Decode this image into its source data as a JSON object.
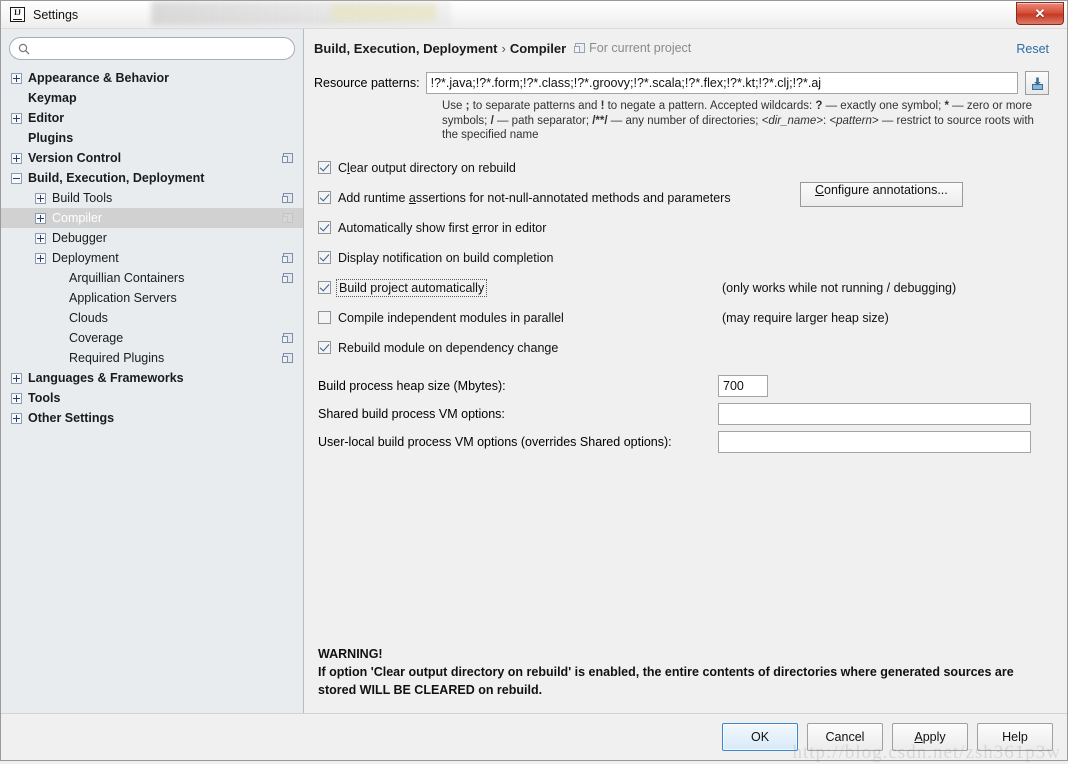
{
  "window": {
    "title": "Settings",
    "app_icon": "intellij-idea-icon",
    "close_label": "✕"
  },
  "sidebar": {
    "search": {
      "value": "",
      "placeholder": "",
      "icon": "search-icon"
    },
    "items": [
      {
        "label": "Appearance & Behavior",
        "toggle": "plus",
        "level": 1,
        "bold": true,
        "selected": false,
        "project_icon": false
      },
      {
        "label": "Keymap",
        "toggle": "none",
        "level": 1,
        "bold": true,
        "selected": false,
        "project_icon": false
      },
      {
        "label": "Editor",
        "toggle": "plus",
        "level": 1,
        "bold": true,
        "selected": false,
        "project_icon": false
      },
      {
        "label": "Plugins",
        "toggle": "none",
        "level": 1,
        "bold": true,
        "selected": false,
        "project_icon": false
      },
      {
        "label": "Version Control",
        "toggle": "plus",
        "level": 1,
        "bold": true,
        "selected": false,
        "project_icon": true
      },
      {
        "label": "Build, Execution, Deployment",
        "toggle": "minus",
        "level": 1,
        "bold": true,
        "selected": false,
        "project_icon": false
      },
      {
        "label": "Build Tools",
        "toggle": "plus",
        "level": 2,
        "bold": false,
        "selected": false,
        "project_icon": true
      },
      {
        "label": "Compiler",
        "toggle": "plus",
        "level": 2,
        "bold": false,
        "selected": true,
        "project_icon": true
      },
      {
        "label": "Debugger",
        "toggle": "plus",
        "level": 2,
        "bold": false,
        "selected": false,
        "project_icon": false
      },
      {
        "label": "Deployment",
        "toggle": "plus",
        "level": 2,
        "bold": false,
        "selected": false,
        "project_icon": true
      },
      {
        "label": "Arquillian Containers",
        "toggle": "none",
        "level": 3,
        "bold": false,
        "selected": false,
        "project_icon": true
      },
      {
        "label": "Application Servers",
        "toggle": "none",
        "level": 3,
        "bold": false,
        "selected": false,
        "project_icon": false
      },
      {
        "label": "Clouds",
        "toggle": "none",
        "level": 3,
        "bold": false,
        "selected": false,
        "project_icon": false
      },
      {
        "label": "Coverage",
        "toggle": "none",
        "level": 3,
        "bold": false,
        "selected": false,
        "project_icon": true
      },
      {
        "label": "Required Plugins",
        "toggle": "none",
        "level": 3,
        "bold": false,
        "selected": false,
        "project_icon": true
      },
      {
        "label": "Languages & Frameworks",
        "toggle": "plus",
        "level": 1,
        "bold": true,
        "selected": false,
        "project_icon": false
      },
      {
        "label": "Tools",
        "toggle": "plus",
        "level": 1,
        "bold": true,
        "selected": false,
        "project_icon": false
      },
      {
        "label": "Other Settings",
        "toggle": "plus",
        "level": 1,
        "bold": true,
        "selected": false,
        "project_icon": false
      }
    ]
  },
  "main": {
    "breadcrumb": {
      "root": "Build, Execution, Deployment",
      "separator": "›",
      "leaf": "Compiler"
    },
    "scope_label": "For current project",
    "reset_label": "Reset",
    "resource_patterns": {
      "label": "Resource patterns:",
      "value": "!?*.java;!?*.form;!?*.class;!?*.groovy;!?*.scala;!?*.flex;!?*.kt;!?*.clj;!?*.aj",
      "button_icon": "import-to-project-icon"
    },
    "hint": {
      "line1_a": "Use ",
      "line1_semi": ";",
      "line1_b": " to separate patterns and ",
      "line1_bang": "!",
      "line1_c": " to negate a pattern. Accepted wildcards: ",
      "line1_q": "?",
      "line1_d": " — exactly one symbol; ",
      "line1_star": "*",
      "line1_e": " — zero or more symbols; ",
      "line2_slash": "/",
      "line2_a": " — path separator; ",
      "line2_dstar": "/**/",
      "line2_b": " — any number of directories; ",
      "line2_dir": "<dir_name>",
      "line2_colon": ": ",
      "line2_pat": "<pattern>",
      "line2_c": " — restrict to source roots with the specified name"
    },
    "checkboxes": [
      {
        "label_pre": "C",
        "label_mn": "l",
        "label_post": "ear output directory on rebuild",
        "checked": true,
        "focused": false,
        "note": "",
        "button": ""
      },
      {
        "label_pre": "Add runtime ",
        "label_mn": "a",
        "label_post": "ssertions for not-null-annotated methods and parameters",
        "checked": true,
        "focused": false,
        "note": "",
        "button": "Configure annotations..."
      },
      {
        "label_pre": "Automatically show first ",
        "label_mn": "e",
        "label_post": "rror in editor",
        "checked": true,
        "focused": false,
        "note": "",
        "button": ""
      },
      {
        "label_pre": "Display notification on build completion",
        "label_mn": "",
        "label_post": "",
        "checked": true,
        "focused": false,
        "note": "",
        "button": ""
      },
      {
        "label_pre": "Build project automatically",
        "label_mn": "",
        "label_post": "",
        "checked": true,
        "focused": true,
        "note": "(only works while not running / debugging)",
        "button": ""
      },
      {
        "label_pre": "Compile independent modules in parallel",
        "label_mn": "",
        "label_post": "",
        "checked": false,
        "focused": false,
        "note": "(may require larger heap size)",
        "button": ""
      },
      {
        "label_pre": "Rebuild module on dependency change",
        "label_mn": "",
        "label_post": "",
        "checked": true,
        "focused": false,
        "note": "",
        "button": ""
      }
    ],
    "configure_annotations_label_pre": "C",
    "configure_annotations_label_mn": "",
    "fields": [
      {
        "label": "Build process heap size (Mbytes):",
        "value": "700",
        "kind": "heap"
      },
      {
        "label": "Shared build process VM options:",
        "value": "",
        "kind": "vm1"
      },
      {
        "label": "User-local build process VM options (overrides Shared options):",
        "value": "",
        "kind": "vm2"
      }
    ],
    "warning": {
      "title": "WARNING!",
      "body": "If option 'Clear output directory on rebuild' is enabled, the entire contents of directories where generated sources are stored WILL BE CLEARED on rebuild."
    }
  },
  "footer": {
    "ok": "OK",
    "cancel": "Cancel",
    "apply_pre": "",
    "apply_mn": "A",
    "apply_post": "pply",
    "help": "Help",
    "watermark": "http://blog.csdn.net/zsh361p3w"
  },
  "colors": {
    "accent": "#2d6ca8",
    "selected_row_bg": "#d1d1d1",
    "sidebar_bg": "#e8ecef",
    "panel_bg": "#f0f0f0",
    "close_red": "#c33a25"
  }
}
